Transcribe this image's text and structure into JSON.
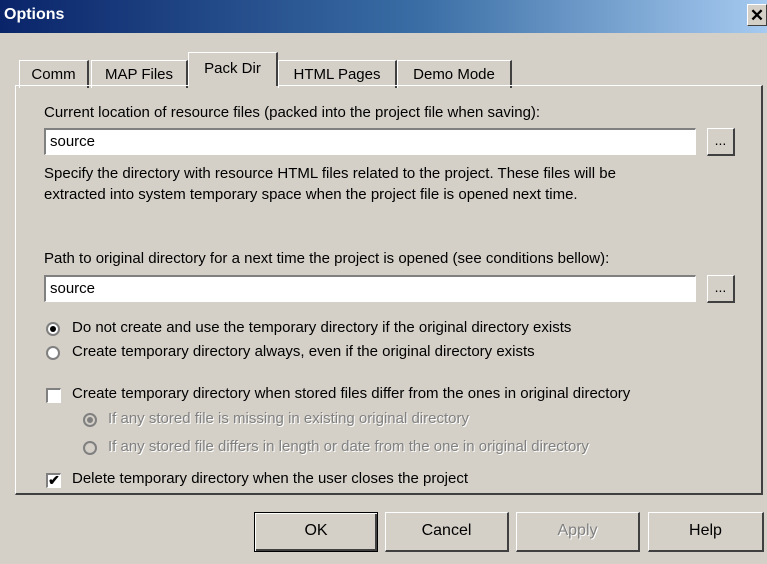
{
  "window": {
    "title": "Options",
    "close_label": "✕"
  },
  "tabs": [
    {
      "label": "Comm",
      "active": false
    },
    {
      "label": "MAP Files",
      "active": false
    },
    {
      "label": "Pack Dir",
      "active": true
    },
    {
      "label": "HTML Pages",
      "active": false
    },
    {
      "label": "Demo Mode",
      "active": false
    }
  ],
  "pack_dir": {
    "current_location_label": "Current location of resource files (packed into the project file when saving):",
    "current_location_value": "source",
    "browse_label": "...",
    "description_line1": "Specify the directory with resource HTML files related to the project. These files will be",
    "description_line2": "extracted into system temporary space when the project file is opened next time.",
    "original_path_label": "Path to original directory for a next time the project is opened (see conditions bellow):",
    "original_path_value": "source",
    "radio_options": [
      {
        "label": "Do not create and use the temporary directory if the original directory exists",
        "selected": true,
        "enabled": true
      },
      {
        "label": "Create temporary directory always, even if the original directory exists",
        "selected": false,
        "enabled": true
      }
    ],
    "create_when_differ": {
      "label": "Create temporary directory when stored files differ from the ones in original directory",
      "checked": false
    },
    "sub_options": [
      {
        "label": "If any stored file is missing in existing original directory",
        "selected": true,
        "enabled": false
      },
      {
        "label": "If any stored file differs in length or date from the one in original directory",
        "selected": false,
        "enabled": false
      }
    ],
    "delete_temp": {
      "label": "Delete temporary directory when the user closes the project",
      "checked": true,
      "mark": "✔"
    }
  },
  "buttons": {
    "ok": "OK",
    "cancel": "Cancel",
    "apply": "Apply",
    "help": "Help"
  }
}
